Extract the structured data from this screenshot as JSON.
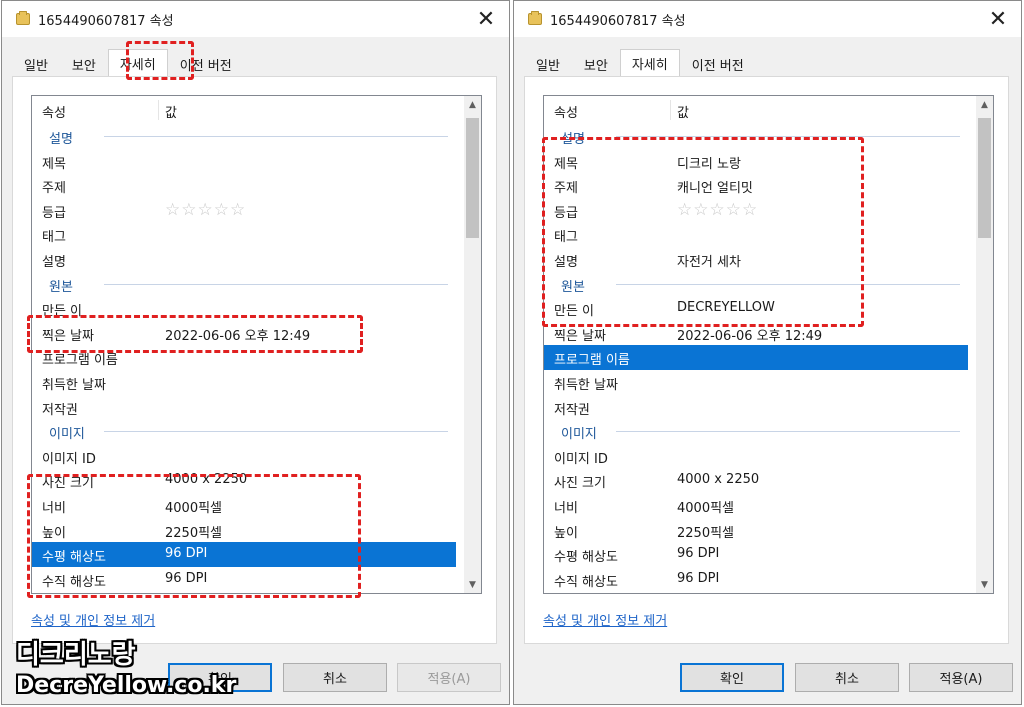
{
  "dialog_title": "1654490607817 속성",
  "close_symbol": "✕",
  "tabs": [
    "일반",
    "보안",
    "자세히",
    "이전 버전"
  ],
  "active_tab": "자세히",
  "columns": {
    "property": "속성",
    "value": "값"
  },
  "stars": "☆☆☆☆☆",
  "scroll_up": "▲",
  "scroll_down": "▼",
  "remove_link": "속성 및 개인 정보 제거",
  "buttons": {
    "ok": "확인",
    "cancel": "취소",
    "apply": "적용(A)"
  },
  "accent_color": "#0a74d4",
  "highlight_color": "#e02020",
  "left": {
    "rows": [
      {
        "type": "group",
        "label": "설명"
      },
      {
        "label": "제목",
        "value": ""
      },
      {
        "label": "주제",
        "value": ""
      },
      {
        "label": "등급",
        "rating": true
      },
      {
        "label": "태그",
        "value": ""
      },
      {
        "label": "설명",
        "value": ""
      },
      {
        "type": "group",
        "label": "원본"
      },
      {
        "label": "만든 이",
        "value": ""
      },
      {
        "label": "찍은 날짜",
        "value": "2022-06-06 오후 12:49"
      },
      {
        "label": "프로그램 이름",
        "value": ""
      },
      {
        "label": "취득한 날짜",
        "value": ""
      },
      {
        "label": "저작권",
        "value": ""
      },
      {
        "type": "group",
        "label": "이미지"
      },
      {
        "label": "이미지 ID",
        "value": ""
      },
      {
        "label": "사진 크기",
        "value": "4000 x 2250"
      },
      {
        "label": "너비",
        "value": "4000픽셀"
      },
      {
        "label": "높이",
        "value": "2250픽셀"
      },
      {
        "label": "수평 해상도",
        "value": "96 DPI",
        "selected": true
      },
      {
        "label": "수직 해상도",
        "value": "96 DPI"
      }
    ]
  },
  "right": {
    "rows": [
      {
        "type": "group",
        "label": "설명"
      },
      {
        "label": "제목",
        "value": "디크리 노랑"
      },
      {
        "label": "주제",
        "value": "캐니언 얼티밋"
      },
      {
        "label": "등급",
        "rating": true
      },
      {
        "label": "태그",
        "value": ""
      },
      {
        "label": "설명",
        "value": "자전거 세차"
      },
      {
        "type": "group",
        "label": "원본"
      },
      {
        "label": "만든 이",
        "value": "DECREYELLOW"
      },
      {
        "label": "찍은 날짜",
        "value": "2022-06-06 오후 12:49"
      },
      {
        "label": "프로그램 이름",
        "value": "",
        "selected": true
      },
      {
        "label": "취득한 날짜",
        "value": ""
      },
      {
        "label": "저작권",
        "value": ""
      },
      {
        "type": "group",
        "label": "이미지"
      },
      {
        "label": "이미지 ID",
        "value": ""
      },
      {
        "label": "사진 크기",
        "value": "4000 x 2250"
      },
      {
        "label": "너비",
        "value": "4000픽셀"
      },
      {
        "label": "높이",
        "value": "2250픽셀"
      },
      {
        "label": "수평 해상도",
        "value": "96 DPI"
      },
      {
        "label": "수직 해상도",
        "value": "96 DPI"
      }
    ]
  },
  "watermark": {
    "line1": "디크리노랑",
    "line2": "DecreYellow.co.kr"
  }
}
